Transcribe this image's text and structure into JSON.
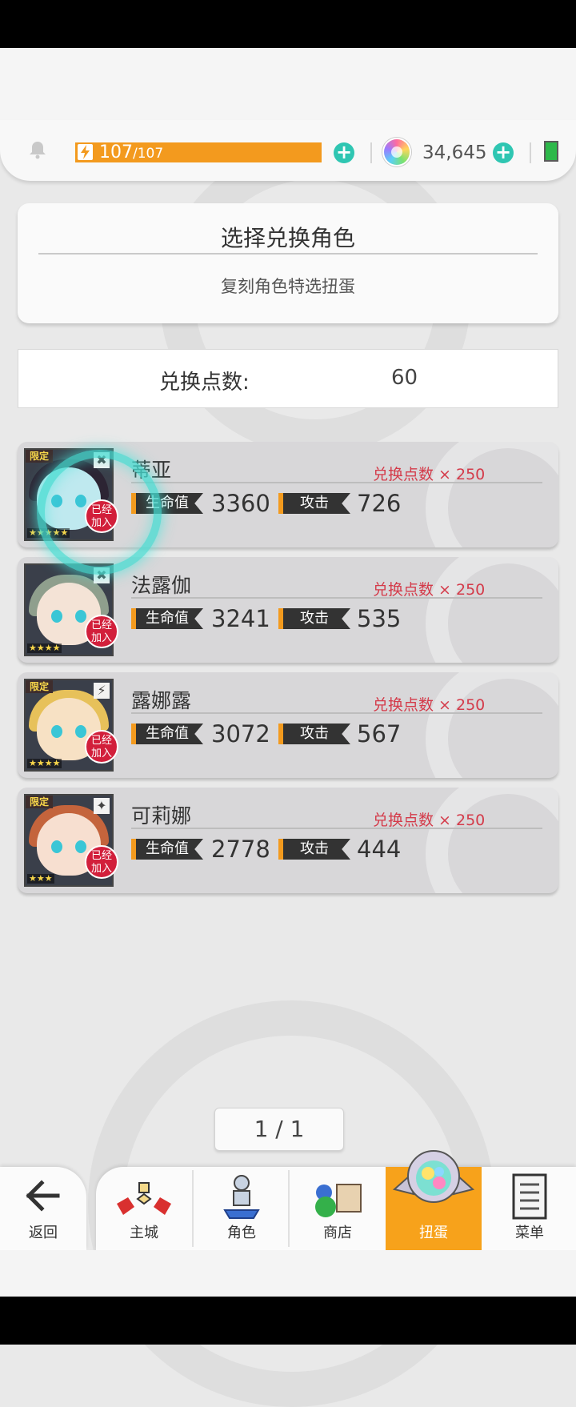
{
  "resources": {
    "stamina_current": "107",
    "stamina_max": "/107",
    "stamina_fill": 1.0,
    "gems": "34,645",
    "add_symbol": "+"
  },
  "header": {
    "title": "选择兑换角色",
    "subtitle": "复刻角色特选扭蛋"
  },
  "points": {
    "label": "兑换点数:",
    "value": "60"
  },
  "labels": {
    "hp": "生命值",
    "atk": "攻击",
    "limited": "限定",
    "joined_line1": "已经",
    "joined_line2": "加入"
  },
  "characters": [
    {
      "name": "蒂亚",
      "cost": "兑换点数 × 250",
      "hp": "3360",
      "atk": "726",
      "stars": "★★★★★",
      "element": "✖",
      "limited": true,
      "hair": "#2c2433",
      "face": "#bfe9ef"
    },
    {
      "name": "法露伽",
      "cost": "兑换点数 × 250",
      "hp": "3241",
      "atk": "535",
      "stars": "★★★★",
      "element": "✖",
      "limited": false,
      "hair": "#8f9f8d",
      "face": "#f4e3d6"
    },
    {
      "name": "露娜露",
      "cost": "兑换点数 × 250",
      "hp": "3072",
      "atk": "567",
      "stars": "★★★★",
      "element": "⚡",
      "limited": true,
      "hair": "#e7c15a",
      "face": "#f7e1c4"
    },
    {
      "name": "可莉娜",
      "cost": "兑换点数 × 250",
      "hp": "2778",
      "atk": "444",
      "stars": "★★★",
      "element": "✦",
      "limited": true,
      "hair": "#c4643c",
      "face": "#f7dfd0"
    }
  ],
  "pager": {
    "text": "1 / 1"
  },
  "nav": {
    "back": "返回",
    "items": [
      "主城",
      "角色",
      "商店",
      "扭蛋",
      "菜单"
    ],
    "active_index": 3
  },
  "colors": {
    "accent": "#f39a1e",
    "cost_red": "#d43b4a",
    "plus_teal": "#2fc6b2",
    "joined_red": "#d21f3b"
  }
}
